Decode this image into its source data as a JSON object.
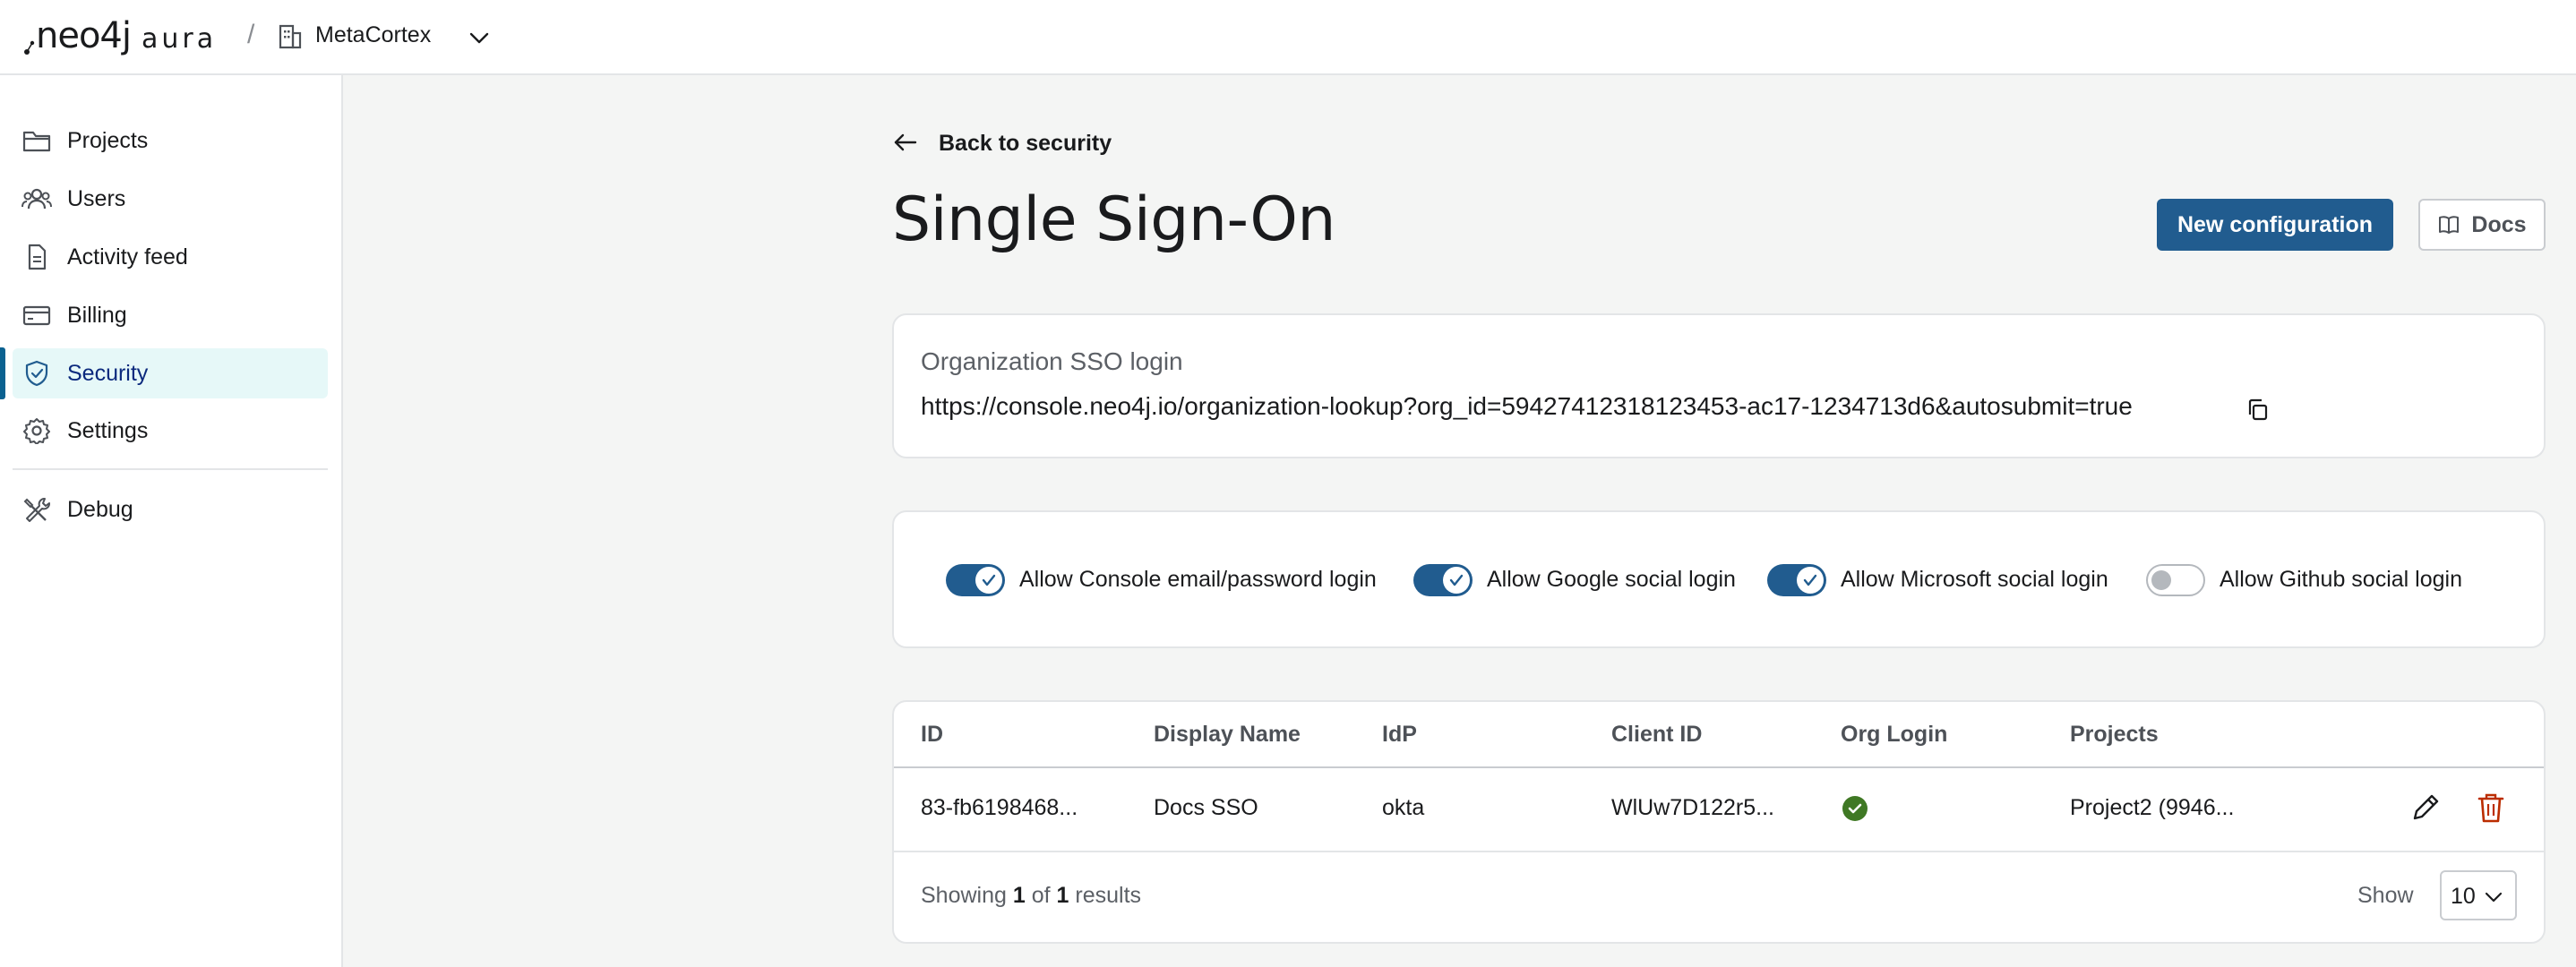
{
  "topbar": {
    "logo_main": "neo4j",
    "logo_sub": "aura",
    "separator": "/",
    "org_name": "MetaCortex"
  },
  "sidebar": {
    "items": [
      {
        "label": "Projects",
        "icon": "folder-icon"
      },
      {
        "label": "Users",
        "icon": "users-icon"
      },
      {
        "label": "Activity feed",
        "icon": "document-icon"
      },
      {
        "label": "Billing",
        "icon": "credit-card-icon"
      },
      {
        "label": "Security",
        "icon": "shield-check-icon",
        "active": true
      },
      {
        "label": "Settings",
        "icon": "gear-icon"
      }
    ],
    "secondary_items": [
      {
        "label": "Debug",
        "icon": "tools-icon"
      }
    ]
  },
  "main": {
    "back_label": "Back to security",
    "title": "Single Sign-On",
    "new_config_label": "New configuration",
    "docs_label": "Docs",
    "sso": {
      "label": "Organization SSO login",
      "url": "https://console.neo4j.io/organization-lookup?org_id=59427412318123453-ac17-1234713d6&autosubmit=true"
    },
    "toggles": [
      {
        "label": "Allow Console email/password login",
        "on": true
      },
      {
        "label": "Allow Google social login",
        "on": true
      },
      {
        "label": "Allow Microsoft social login",
        "on": true
      },
      {
        "label": "Allow Github social login",
        "on": false
      }
    ],
    "table": {
      "columns": [
        "ID",
        "Display Name",
        "IdP",
        "Client ID",
        "Org Login",
        "Projects"
      ],
      "rows": [
        {
          "id": "83-fb6198468...",
          "display_name": "Docs SSO",
          "idp": "okta",
          "client_id": "WlUw7D122r5...",
          "org_login": true,
          "projects": "Project2 (9946..."
        }
      ],
      "footer": {
        "prefix": "Showing",
        "from": "1",
        "of_word": "of",
        "total": "1",
        "suffix": "results"
      },
      "show_label": "Show",
      "page_size": "10"
    }
  },
  "colors": {
    "primary": "#215c8f",
    "active_nav_bg": "#e6f8f8",
    "success": "#3f7824",
    "danger": "#bb2d00"
  }
}
